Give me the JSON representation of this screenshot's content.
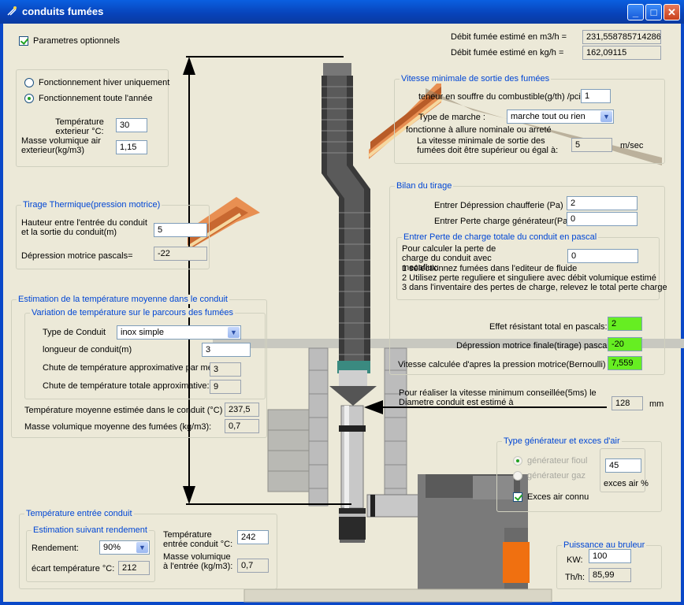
{
  "window": {
    "title": "conduits fumées"
  },
  "options": {
    "label": "Parametres optionnels",
    "checked": true
  },
  "debit": {
    "m3_label": "Débit fumée estimé en m3/h =",
    "m3_value": "231,558785714286",
    "kg_label": "Débit fumée estimé en kg/h =",
    "kg_value": "162,09115"
  },
  "fonctionnement": {
    "hiver_label": "Fonctionnement hiver uniquement",
    "annee_label": "Fonctionnement toute l'année",
    "selected": "annee",
    "temp_ext_label": "Température exterieur °C:",
    "temp_ext_value": "30",
    "masse_label": "Masse volumique air exterieur(kg/m3)",
    "masse_value": "1,15"
  },
  "tirage": {
    "title": "Tirage Thermique(pression motrice)",
    "hauteur_label": "Hauteur entre l'entrée du conduit et la sortie du conduit(m)",
    "hauteur_value": "5",
    "depression_label": "Dépression motrice pascals=",
    "depression_value": "-22"
  },
  "estimation": {
    "title": "Estimation de la température moyenne dans le conduit",
    "variation_title": "Variation de température sur le parcours des fumées",
    "type_label": "Type de Conduit",
    "type_value": "inox simple",
    "longueur_label": "longueur de conduit(m)",
    "longueur_value": "3",
    "chute_metre_label": "Chute de température approximative par metre",
    "chute_metre_value": "3",
    "chute_totale_label": "Chute de température totale approximative:",
    "chute_totale_value": "9",
    "temp_moy_label": "Température moyenne estimée dans le conduit (°C)",
    "temp_moy_value": "237,5",
    "masse_moy_label": "Masse volumique moyenne des fumées (kg/m3):",
    "masse_moy_value": "0,7"
  },
  "entree": {
    "title": "Température entrée conduit",
    "rendement_title": "Estimation suivant rendement",
    "rendement_label": "Rendement:",
    "rendement_value": "90%",
    "ecart_label": "écart température °C:",
    "ecart_value": "212",
    "temp_entree_label": "Température entrée conduit °C:",
    "temp_entree_value": "242",
    "masse_entree_label": "Masse volumique à l'entrée (kg/m3):",
    "masse_entree_value": "0,7"
  },
  "vitesse": {
    "title": "Vitesse minimale de sortie des fumées",
    "soufre_label": "teneur en souffre du combustible(g/th) /pci:",
    "soufre_value": "1",
    "marche_label": "Type de marche :",
    "marche_value": "marche tout ou rien",
    "allure_label": "fonctionne à allure nominale ou arreté",
    "min_label": "La vitesse minimale de sortie des fumées doit être supérieur ou égal à:",
    "min_value": "5",
    "min_unit": "m/sec"
  },
  "bilan": {
    "title": "Bilan du tirage",
    "dep_chauff_label": "Entrer Dépression chaufferie (Pa)",
    "dep_chauff_value": "2",
    "perte_gen_label": "Entrer Perte charge générateur(Pa)",
    "perte_gen_value": "0",
    "perte_total_title": "Entrer Perte de charge totale du conduit en pascal",
    "calc_label": "Pour calculer la perte de charge du conduit avec mecaflux:",
    "calc_value": "0",
    "step1": "1 sélectionnez fumées dans l'editeur de fluide",
    "step2": "2 Utilisez  perte reguliere et singuliere avec débit volumique estimé",
    "step3": "3 dans l'inventaire des pertes de charge, relevez le total perte charge",
    "effet_label": "Effet résistant total en pascals:",
    "effet_value": "2",
    "dep_finale_label": "Dépression motrice finale(tirage) pascals",
    "dep_finale_value": "-20",
    "vitesse_label": "Vitesse calculée d'apres la pression motrice(Bernoulli) ms",
    "vitesse_value": "7,559",
    "green_color": "#66ee22"
  },
  "diametre": {
    "label": "Pour réaliser la vitesse minimum conseillée(5ms) le Diametre conduit est estimé à",
    "value": "128",
    "unit": "mm"
  },
  "generateur": {
    "title": "Type générateur et exces d'air",
    "fioul_label": "générateur fioul",
    "gaz_label": "générateur gaz",
    "exces_value": "45",
    "exces_label": "exces air %",
    "connu_label": "Exces air connu",
    "connu_checked": true
  },
  "puissance": {
    "title": "Puissance au bruleur",
    "kw_label": "KW:",
    "kw_value": "100",
    "thh_label": "Th/h:",
    "thh_value": "85,99"
  },
  "colors": {
    "title_bar": "#0a48c8",
    "group_title": "#0046d5",
    "burner_orange": "#f07010"
  }
}
